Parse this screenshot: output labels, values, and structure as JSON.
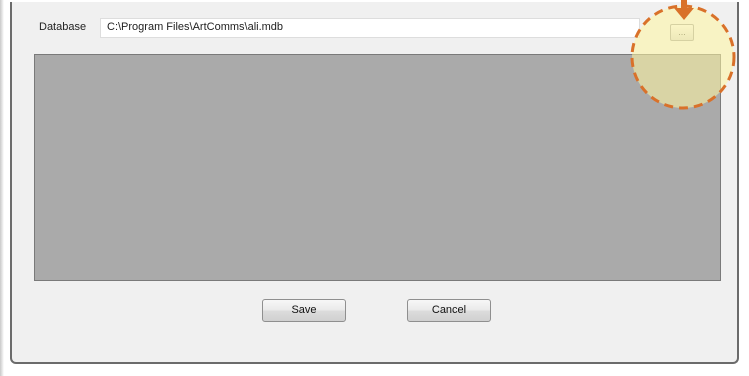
{
  "database": {
    "label": "Database",
    "path": "C:\\Program Files\\ArtComms\\ali.mdb",
    "browse_label": "..."
  },
  "buttons": {
    "save_label": "Save",
    "cancel_label": "Cancel"
  },
  "colors": {
    "dialog_background": "#f0f0f0",
    "grid_background": "#aaaaaa",
    "highlight_fill": "#fff7a8",
    "highlight_stroke": "#d9712a"
  },
  "icons": {
    "annotation_arrow": "arrow-down-icon",
    "annotation_circle": "highlight-circle"
  }
}
